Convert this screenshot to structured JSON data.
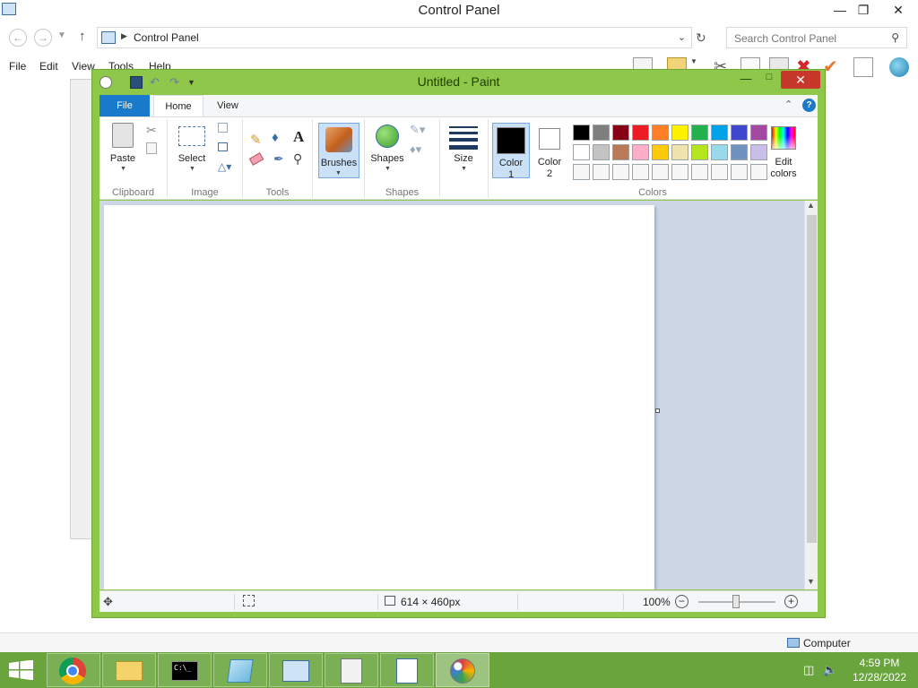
{
  "control_panel": {
    "title": "Control Panel",
    "address": "Control Panel",
    "search_placeholder": "Search Control Panel",
    "menu": [
      "File",
      "Edit",
      "View",
      "Tools",
      "Help"
    ],
    "status_computer": "Computer"
  },
  "paint": {
    "title": "Untitled - Paint",
    "tabs": {
      "file": "File",
      "home": "Home",
      "view": "View"
    },
    "groups": {
      "clipboard": {
        "label": "Clipboard",
        "paste": "Paste"
      },
      "image": {
        "label": "Image",
        "select": "Select"
      },
      "tools": {
        "label": "Tools"
      },
      "brushes": {
        "label": "Brushes"
      },
      "shapes": {
        "label": "Shapes",
        "shapes": "Shapes"
      },
      "size": {
        "label": "Size"
      },
      "colors": {
        "label": "Colors",
        "color1": "Color\n1",
        "color1_line1": "Color",
        "color1_line2": "1",
        "color2_line1": "Color",
        "color2_line2": "2",
        "edit_line1": "Edit",
        "edit_line2": "colors",
        "palette_row1": [
          "#000000",
          "#7f7f7f",
          "#880015",
          "#ed1c24",
          "#ff7f27",
          "#fff200",
          "#22b14c",
          "#00a2e8",
          "#3f48cc",
          "#a349a4"
        ],
        "palette_row2": [
          "#ffffff",
          "#c3c3c3",
          "#b97a57",
          "#ffaec9",
          "#ffc90e",
          "#efe4b0",
          "#b5e61d",
          "#99d9ea",
          "#7092be",
          "#c8bfe7"
        ],
        "palette_row3": [
          "#f7f7f7",
          "#f7f7f7",
          "#f7f7f7",
          "#f7f7f7",
          "#f7f7f7",
          "#f7f7f7",
          "#f7f7f7",
          "#f7f7f7",
          "#f7f7f7",
          "#f7f7f7"
        ]
      }
    },
    "status": {
      "canvas_size": "614 × 460px",
      "zoom": "100%"
    }
  },
  "taskbar": {
    "time": "4:59 PM",
    "date": "12/28/2022",
    "apps": [
      "chrome-icon",
      "file-explorer-icon",
      "command-prompt-icon",
      "notepad-icon",
      "control-panel-icon",
      "calculator-icon",
      "wordpad-icon",
      "paint-icon"
    ]
  }
}
